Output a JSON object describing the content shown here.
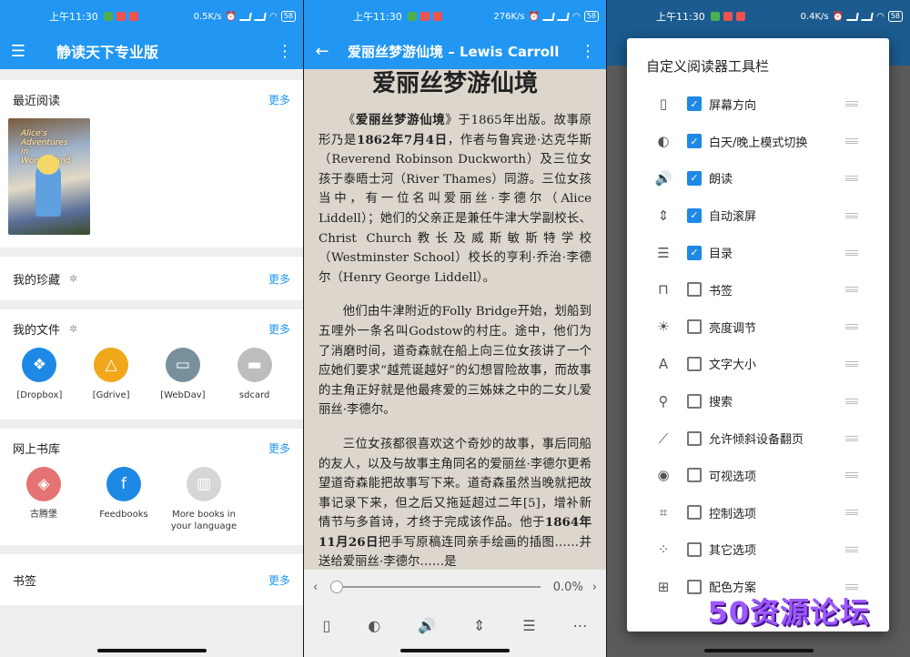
{
  "status_bars": [
    {
      "time": "上午11:30",
      "speed": "0.5K/s",
      "battery": "58"
    },
    {
      "time": "上午11:30",
      "speed": "276K/s",
      "battery": "58"
    },
    {
      "time": "上午11:30",
      "speed": "0.4K/s",
      "battery": "58"
    }
  ],
  "library": {
    "title": "静读天下专业版",
    "recent": {
      "label": "最近阅读",
      "more": "更多",
      "book_cover_text": "Alice's Adventures in Wonderland"
    },
    "favorites": {
      "label": "我的珍藏",
      "more": "更多"
    },
    "files": {
      "label": "我的文件",
      "more": "更多",
      "items": [
        {
          "label": "[Dropbox]",
          "color": "#1e88e5",
          "icon": "dropbox-icon"
        },
        {
          "label": "[Gdrive]",
          "color": "#f0a71a",
          "icon": "gdrive-icon"
        },
        {
          "label": "[WebDav]",
          "color": "#78909c",
          "icon": "webdav-icon"
        },
        {
          "label": "sdcard",
          "color": "#bdbdbd",
          "icon": "folder-icon"
        }
      ]
    },
    "online": {
      "label": "网上书库",
      "more": "更多",
      "items": [
        {
          "label": "古腾堡",
          "color": "#e57373",
          "icon": "gutenberg-icon"
        },
        {
          "label": "Feedbooks",
          "color": "#1e88e5",
          "icon": "feedbooks-icon"
        },
        {
          "label": "More books in your language",
          "color": "#d6d6d6",
          "icon": "book-icon"
        }
      ]
    },
    "bookmarks": {
      "label": "书签",
      "more": "更多"
    }
  },
  "reader": {
    "header": "爱丽丝梦游仙境 – Lewis Carroll",
    "title": "爱丽丝梦游仙境",
    "progress": "0.0%",
    "progress_value": 0.0,
    "paragraphs": [
      {
        "parts": [
          "《",
          "爱丽丝梦游仙境",
          "》于1865年出版。故事原形乃是",
          "1862年7月4日",
          "，作者与鲁宾逊·达克华斯（Reverend Robinson Duckworth）及三位女孩于泰晤士河（River Thames）同游。三位女孩当中，有一位名叫爱丽丝·李德尔（Alice Liddell）；她们的父亲正是兼任牛津大学副校长、Christ Church教长及威斯敏斯特学校（Westminster School）校长的亨利·乔治·李德尔（Henry George Liddell）。"
        ]
      },
      {
        "parts": [
          "他们由牛津附近的Folly Bridge开始，划船到五哩外一条名叫Godstow的村庄。途中，他们为了消磨时间，道奇森就在船上向三位女孩讲了一个应她们要求“越荒诞越好”的幻想冒险故事，而故事的主角正好就是他最疼爱的三姊妹之中的二女儿爱丽丝·李德尔。"
        ]
      },
      {
        "parts": [
          "三位女孩都很喜欢这个奇妙的故事，事后同船的友人，以及与故事主角同名的爱丽丝·李德尔更希望道奇森能把故事写下来。道奇森虽然当晚就把故事记录下来，但之后又拖延超过二年[5]，增补新情节与多首诗，才终于完成该作品。他于",
          "1864年11月26日",
          "把手写原稿连同亲手绘画的插图……并送给爱丽丝·李德尔……是"
        ]
      }
    ]
  },
  "toolbar_dialog": {
    "title": "自定义阅读器工具栏",
    "options": [
      {
        "label": "屏幕方向",
        "checked": true,
        "icon": "screen-rotation-icon",
        "glyph": "▯"
      },
      {
        "label": "白天/晚上模式切换",
        "checked": true,
        "icon": "day-night-icon",
        "glyph": "◐"
      },
      {
        "label": "朗读",
        "checked": true,
        "icon": "speaker-icon",
        "glyph": "🔊"
      },
      {
        "label": "自动滚屏",
        "checked": true,
        "icon": "auto-scroll-icon",
        "glyph": "⇕"
      },
      {
        "label": "目录",
        "checked": true,
        "icon": "toc-icon",
        "glyph": "☰"
      },
      {
        "label": "书签",
        "checked": false,
        "icon": "bookmark-icon",
        "glyph": "⊓"
      },
      {
        "label": "亮度调节",
        "checked": false,
        "icon": "brightness-icon",
        "glyph": "☀"
      },
      {
        "label": "文字大小",
        "checked": false,
        "icon": "font-size-icon",
        "glyph": "A"
      },
      {
        "label": "搜索",
        "checked": false,
        "icon": "search-icon",
        "glyph": "⚲"
      },
      {
        "label": "允许倾斜设备翻页",
        "checked": false,
        "icon": "tilt-icon",
        "glyph": "⟋"
      },
      {
        "label": "可视选项",
        "checked": false,
        "icon": "eye-icon",
        "glyph": "◉"
      },
      {
        "label": "控制选项",
        "checked": false,
        "icon": "control-icon",
        "glyph": "⌗"
      },
      {
        "label": "其它选项",
        "checked": false,
        "icon": "dots-grid-icon",
        "glyph": "⁘"
      },
      {
        "label": "配色方案",
        "checked": false,
        "icon": "color-scheme-icon",
        "glyph": "⊞"
      }
    ]
  },
  "watermark": "50资源论坛"
}
